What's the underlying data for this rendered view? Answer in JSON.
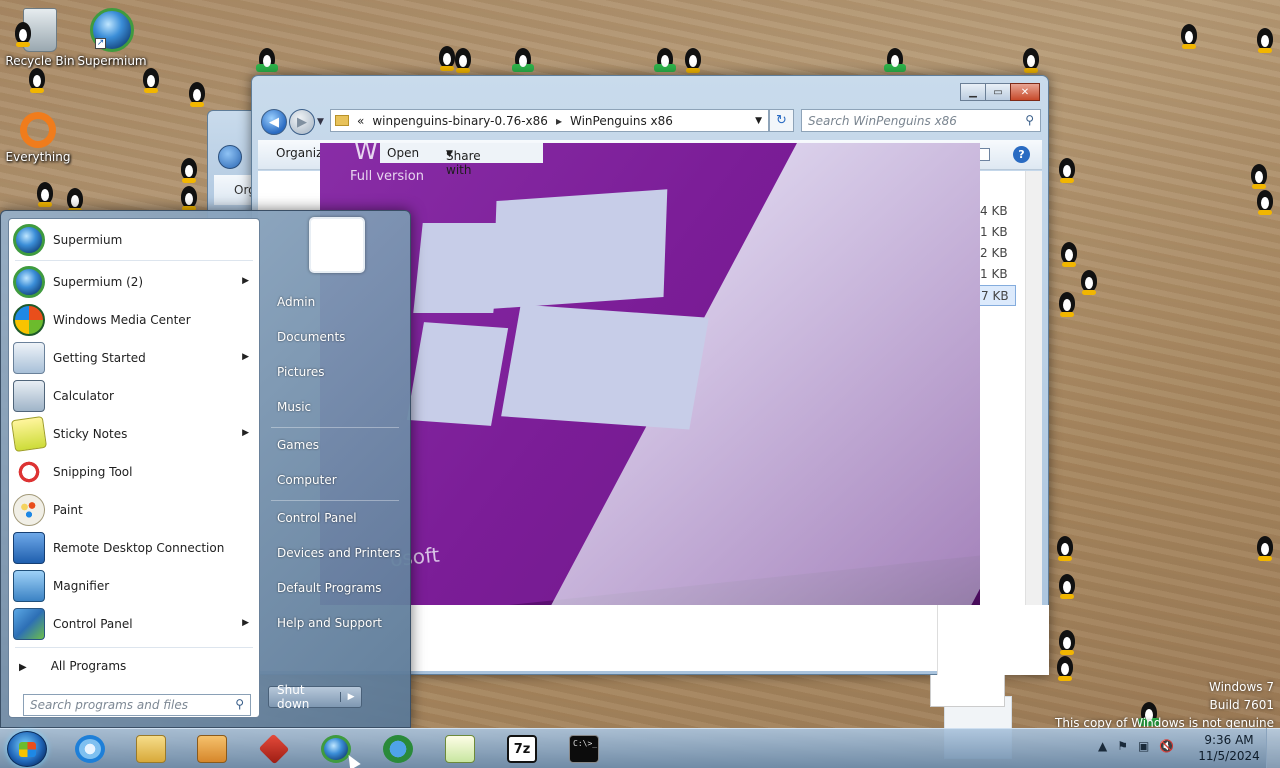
{
  "desktop": {
    "icons": [
      {
        "label": "Recycle Bin"
      },
      {
        "label": "Supermium"
      },
      {
        "label": "Everything"
      }
    ]
  },
  "explorer": {
    "address": {
      "chevron": "«",
      "crumb1": "winpenguins-binary-0.76-x86",
      "crumb2": "WinPenguins x86"
    },
    "search_placeholder": "Search WinPenguins x86",
    "toolbar": {
      "organize": "Organize",
      "open": "Open",
      "share_with": "Share with"
    },
    "sizes": [
      "4 KB",
      "1 KB",
      "2 KB",
      "1 KB",
      "7 KB"
    ],
    "back_window_toolbar": "Org"
  },
  "photo": {
    "brand_fragment": "W",
    "edition": "Full version",
    "maker_fragment": "osoft"
  },
  "start_menu": {
    "programs": [
      {
        "label": "Supermium",
        "icon": "supermium-icon",
        "submenu": false
      },
      {
        "label": "Supermium (2)",
        "icon": "supermium-icon",
        "submenu": true
      },
      {
        "label": "Windows Media Center",
        "icon": "media-center-icon",
        "submenu": false
      },
      {
        "label": "Getting Started",
        "icon": "getting-started-icon",
        "submenu": true
      },
      {
        "label": "Calculator",
        "icon": "calculator-icon",
        "submenu": false
      },
      {
        "label": "Sticky Notes",
        "icon": "sticky-notes-icon",
        "submenu": true
      },
      {
        "label": "Snipping Tool",
        "icon": "snipping-tool-icon",
        "submenu": false
      },
      {
        "label": "Paint",
        "icon": "paint-icon",
        "submenu": false
      },
      {
        "label": "Remote Desktop Connection",
        "icon": "remote-desktop-icon",
        "submenu": false
      },
      {
        "label": "Magnifier",
        "icon": "magnifier-icon",
        "submenu": false
      },
      {
        "label": "Control Panel",
        "icon": "control-panel-icon",
        "submenu": true
      }
    ],
    "all_programs": "All Programs",
    "search_placeholder": "Search programs and files",
    "right": {
      "admin": "Admin",
      "documents": "Documents",
      "pictures": "Pictures",
      "music": "Music",
      "games": "Games",
      "computer": "Computer",
      "control_panel": "Control Panel",
      "devices_printers": "Devices and Printers",
      "default_programs": "Default Programs",
      "help_support": "Help and Support"
    },
    "shutdown": "Shut down"
  },
  "taskbar": {
    "apps": [
      "internet-explorer-icon",
      "file-explorer-icon",
      "media-player-icon",
      "red-app-icon",
      "supermium-icon",
      "download-globe-icon",
      "notepad-plus-icon",
      "7zip-icon",
      "command-prompt-icon"
    ],
    "cmd_glyph": "C:\\>_",
    "sevenzip_glyph": "7z",
    "time": "9:36 AM",
    "date": "11/5/2024"
  },
  "watermark": {
    "line1": "Windows 7",
    "line2": "Build 7601",
    "line3": "This copy of Windows is not genuine"
  },
  "colors": {
    "start_menu_blue": "#6f8fae",
    "taskbar_blue": "#8fb0cf",
    "box_purple": "#7b1d97",
    "close_red": "#c74a2b"
  }
}
